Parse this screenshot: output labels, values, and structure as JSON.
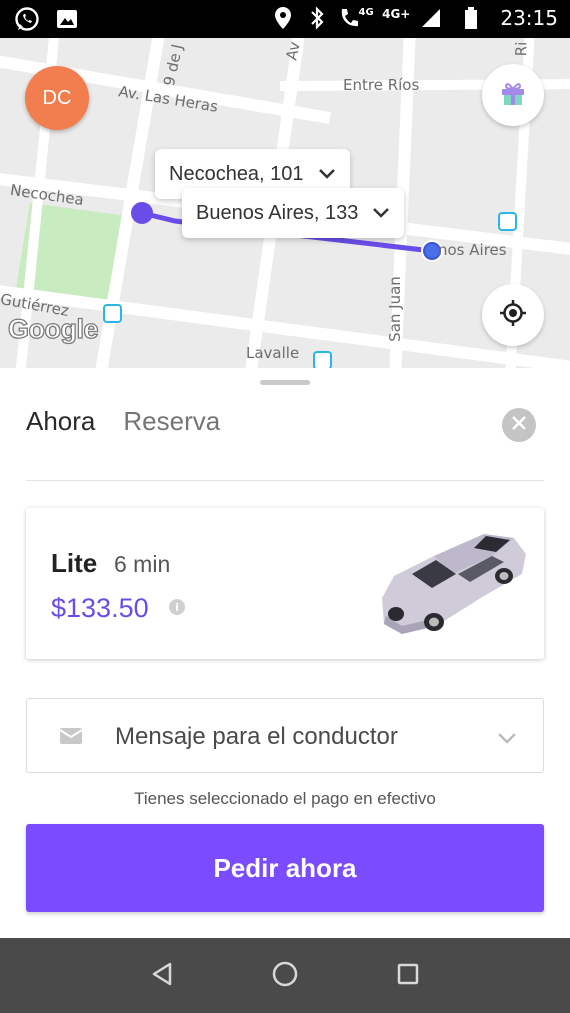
{
  "status_bar": {
    "network_label": "4G",
    "network_label_2": "4G+",
    "time": "23:15",
    "icons": [
      "whatsapp-icon",
      "gallery-icon",
      "location-icon",
      "bluetooth-icon",
      "call-icon",
      "signal-icon",
      "battery-icon"
    ]
  },
  "map": {
    "streets": {
      "las_heras": "Av. Las Heras",
      "entre_rios": "Entre Ríos",
      "necochea": "Necochea",
      "gutierrez": "Gutiérrez",
      "lavalle": "Lavalle",
      "san_juan": "San Juan",
      "nueve_de": "9 de J",
      "av": "Av",
      "ri": "Ri",
      "buenos_aires": "nos Aires"
    },
    "avatar_initials": "DC",
    "origin_tag": "Necochea, 101",
    "destination_tag": "Buenos Aires, 133",
    "google_logo": "Google",
    "colors": {
      "route": "#6a4de8",
      "park": "#c8ecc0",
      "street": "#ffffff",
      "background": "#ebebeb"
    }
  },
  "sheet": {
    "tabs": [
      "Ahora",
      "Reserva"
    ],
    "ride": {
      "name": "Lite",
      "eta": "6 min",
      "price": "$133.50"
    },
    "message_placeholder": "Mensaje para el conductor",
    "payment_note": "Tienes seleccionado el pago en efectivo",
    "order_button": "Pedir ahora",
    "colors": {
      "accent": "#7a4bff",
      "price": "#6a4de8"
    }
  },
  "nav_bar": {
    "buttons": [
      "back-icon",
      "home-icon",
      "recents-icon"
    ]
  }
}
